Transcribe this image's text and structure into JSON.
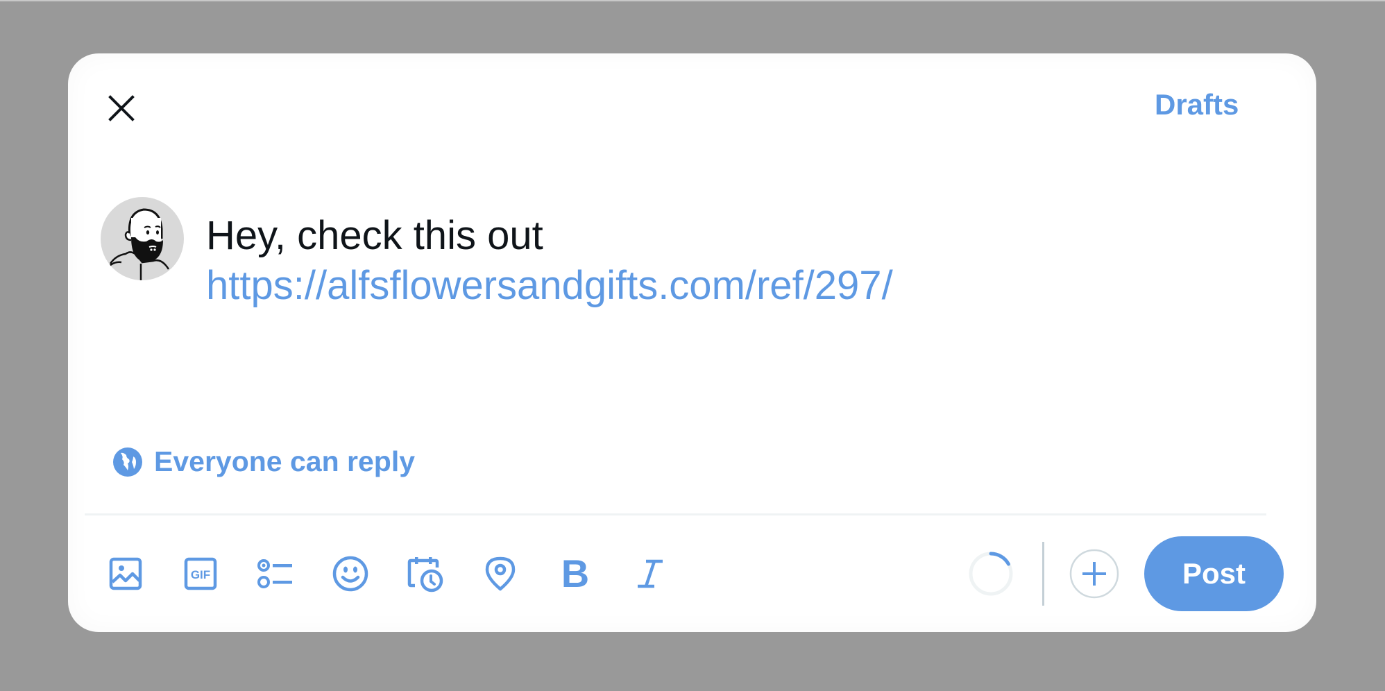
{
  "header": {
    "close_icon": "close-icon",
    "drafts_label": "Drafts"
  },
  "composer": {
    "avatar_icon": "user-avatar-bearded-man",
    "text_line": "Hey, check this out",
    "link_text": "https://alfsflowersandgifts.com/ref/297/"
  },
  "reply_setting": {
    "icon": "globe-icon",
    "label": "Everyone can reply"
  },
  "toolbar": {
    "tools": [
      {
        "name": "media",
        "icon": "image-icon"
      },
      {
        "name": "gif",
        "icon": "gif-icon",
        "text": "GIF"
      },
      {
        "name": "poll",
        "icon": "poll-icon"
      },
      {
        "name": "emoji",
        "icon": "emoji-icon"
      },
      {
        "name": "schedule",
        "icon": "schedule-icon"
      },
      {
        "name": "location",
        "icon": "location-icon"
      },
      {
        "name": "bold",
        "icon": "bold-icon",
        "text": "B"
      },
      {
        "name": "italic",
        "icon": "italic-icon",
        "text": "I"
      }
    ],
    "character_progress": 0.17,
    "add_thread_icon": "plus-icon",
    "post_label": "Post"
  },
  "colors": {
    "accent": "#5e99e3",
    "text": "#0f1419",
    "backdrop": "#999999",
    "divider": "#eff3f4",
    "progress_track": "#eff3f4"
  }
}
